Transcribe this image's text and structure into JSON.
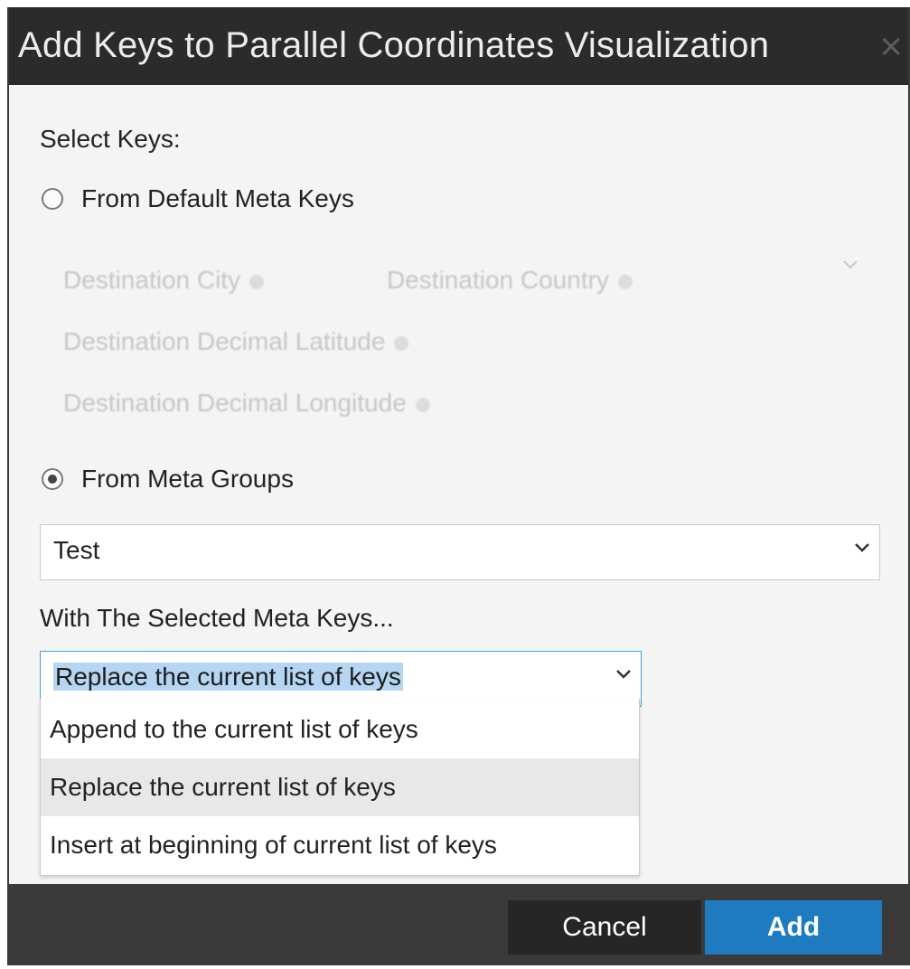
{
  "dialog": {
    "title": "Add Keys to Parallel Coordinates Visualization",
    "close_glyph": "×"
  },
  "select_keys_label": "Select Keys:",
  "default_meta_keys": {
    "radio_label": "From Default Meta Keys",
    "checked": false,
    "chips": [
      "Destination City",
      "Destination Country",
      "Destination Decimal Latitude",
      "Destination Decimal Longitude"
    ]
  },
  "meta_groups": {
    "radio_label": "From Meta Groups",
    "checked": true,
    "selected_value": "Test"
  },
  "action": {
    "label": "With The Selected Meta Keys...",
    "selected_value": "Replace the current list of keys",
    "options": [
      "Append to the current list of keys",
      "Replace the current list of keys",
      "Insert at beginning of current list of keys"
    ]
  },
  "footer": {
    "cancel_label": "Cancel",
    "add_label": "Add"
  },
  "colors": {
    "titlebar": "#2b2b2b",
    "footer": "#3a3a3a",
    "primary_button": "#1f7bc0",
    "focus_border": "#3ea2d6",
    "selection_highlight": "#b6d5f2"
  },
  "icons": [
    "close-icon",
    "chevron-down-icon"
  ]
}
